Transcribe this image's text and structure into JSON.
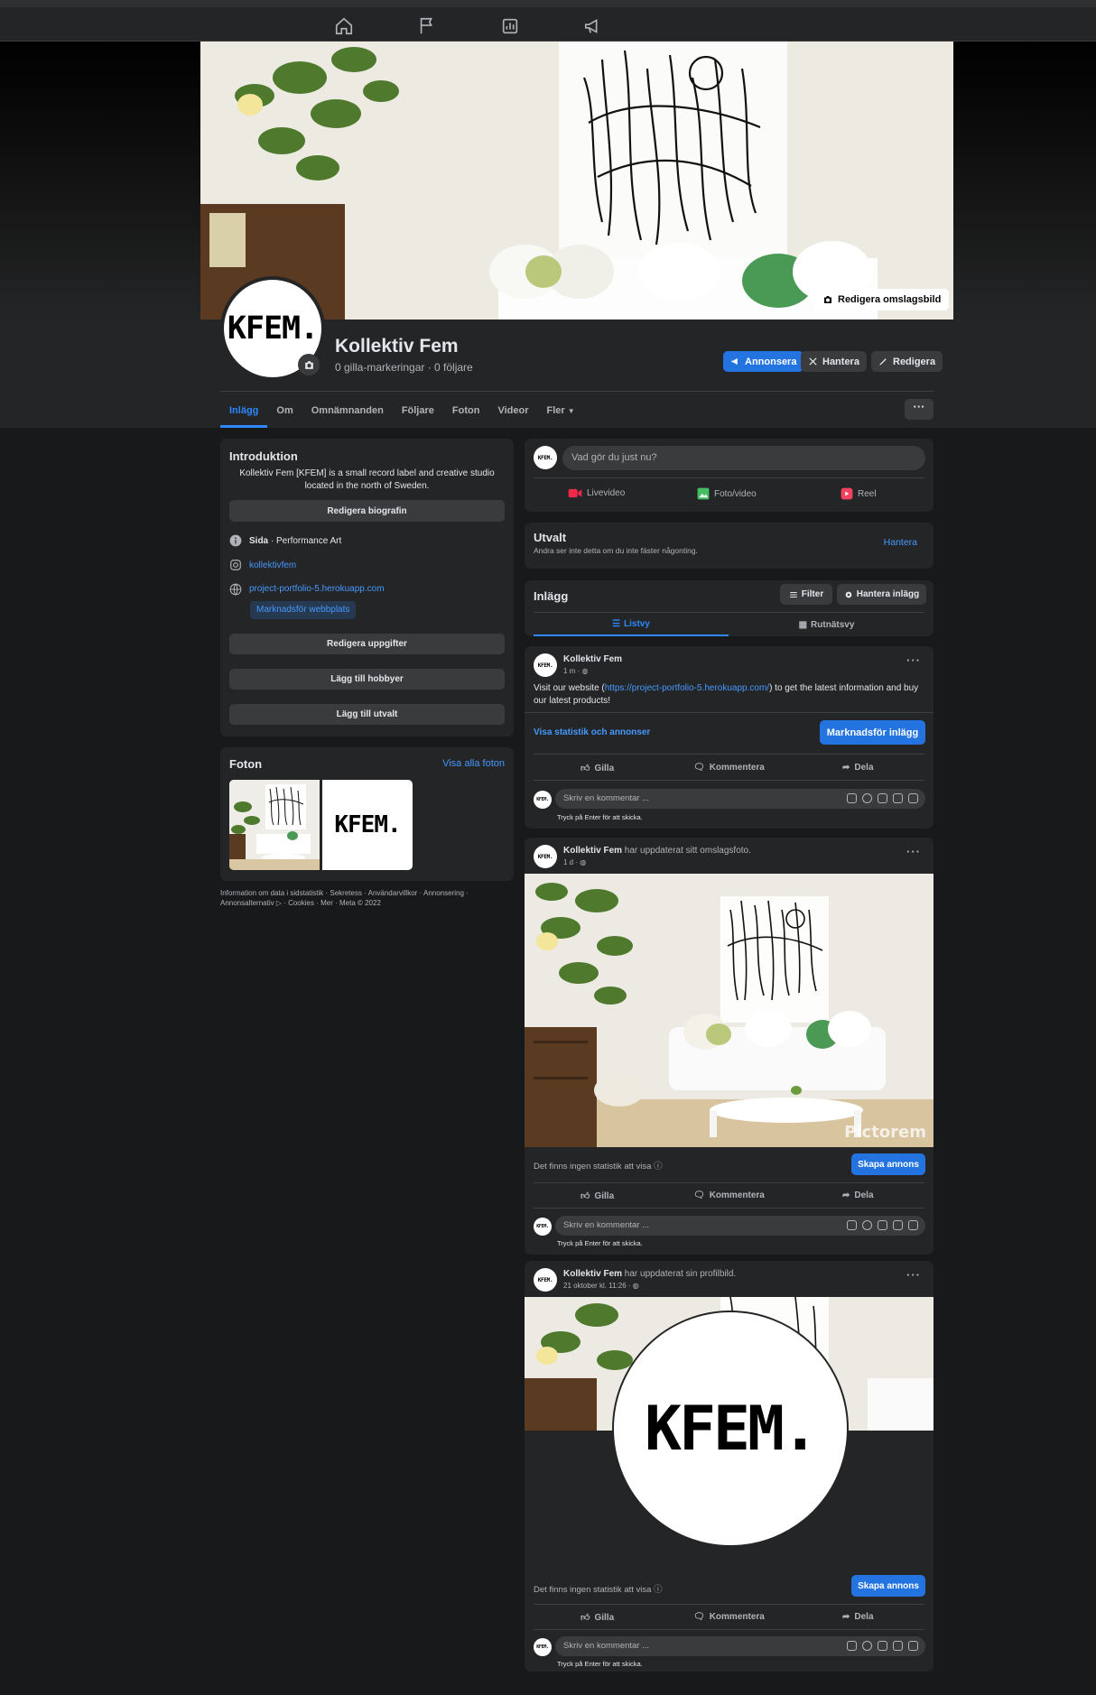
{
  "nav": {
    "icons": [
      "home-icon",
      "flag-icon",
      "insights-icon",
      "megaphone-icon"
    ]
  },
  "cover": {
    "edit_label": "Redigera omslagsbild"
  },
  "profile": {
    "logo_text": "KFEM.",
    "name": "Kollektiv Fem",
    "stats": "0 gilla-markeringar · 0 följare"
  },
  "header_buttons": {
    "advertise": "Annonsera",
    "manage": "Hantera",
    "edit": "Redigera"
  },
  "tabs": [
    "Inlägg",
    "Om",
    "Omnämnanden",
    "Följare",
    "Foton",
    "Videor",
    "Fler"
  ],
  "more_button": "···",
  "intro": {
    "title": "Introduktion",
    "bio": "Kollektiv Fem [KFEM] is a small record label and creative studio located in the north of Sweden.",
    "edit_bio": "Redigera biografin",
    "category_label": "Sida",
    "category_value": " · Performance Art",
    "instagram": "kollektivfem",
    "website": "project-portfolio-5.herokuapp.com",
    "promote_website": "Marknadsför webbplats",
    "edit_details": "Redigera uppgifter",
    "add_hobbies": "Lägg till hobbyer",
    "add_featured": "Lägg till utvalt"
  },
  "photos": {
    "title": "Foton",
    "see_all": "Visa alla foton",
    "logo_text": "KFEM."
  },
  "footer": "Information om data i sidstatistik · Sekretess · Användarvillkor · Annonsering · Annonsalternativ ▷ · Cookies · Mer · Meta © 2022",
  "composer": {
    "placeholder": "Vad gör du just nu?",
    "live": "Livevideo",
    "photo": "Foto/video",
    "reel": "Reel",
    "avatar": "KFEM."
  },
  "featured": {
    "title": "Utvalt",
    "subtitle": "Andra ser inte detta om du inte fäster någonting.",
    "manage": "Hantera"
  },
  "posts_header": {
    "title": "Inlägg",
    "filter": "Filter",
    "manage": "Hantera inlägg",
    "list_view": "Listvy",
    "grid_view": "Rutnätsvy"
  },
  "posts": [
    {
      "author": "Kollektiv Fem",
      "action": "",
      "time": "1 m · ",
      "text_before": "Visit our website (",
      "link": "https://project-portfolio-5.herokuapp.com/",
      "text_after": ") to get the latest information and buy our latest products!",
      "stats_link": "Visa statistik och annonser",
      "promote": "Marknadsför inlägg"
    },
    {
      "author": "Kollektiv Fem",
      "action": " har uppdaterat sitt omslagsfoto.",
      "time": "1 d · ",
      "no_stats": "Det finns ingen statistik att visa",
      "create_ad": "Skapa annons",
      "watermark": "Pictorem"
    },
    {
      "author": "Kollektiv Fem",
      "action": " har uppdaterat sin profilbild.",
      "time": "21 oktober kl. 11:26 · ",
      "no_stats": "Det finns ingen statistik att visa",
      "create_ad": "Skapa annons",
      "logo_text": "KFEM."
    }
  ],
  "post_actions": {
    "like": "Gilla",
    "comment": "Kommentera",
    "share": "Dela",
    "comment_placeholder": "Skriv en kommentar ...",
    "enter_hint": "Tryck på Enter för att skicka."
  },
  "colors": {
    "background": "#18191a",
    "card": "#242526",
    "accent": "#2374e1",
    "link": "#4599ff"
  }
}
